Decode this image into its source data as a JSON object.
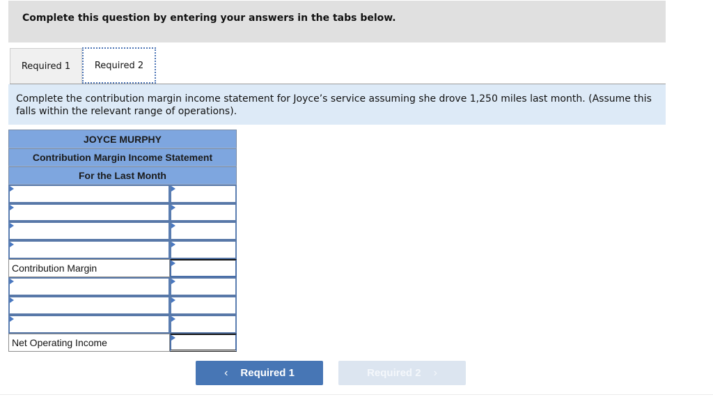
{
  "header": {
    "title": "Complete this question by entering your answers in the tabs below."
  },
  "tabs": [
    {
      "label": "Required 1",
      "active": false
    },
    {
      "label": "Required 2",
      "active": true
    }
  ],
  "instructions": "Complete the contribution margin income statement for Joyce’s service assuming she drove 1,250 miles last month. (Assume this falls within the relevant range of operations).",
  "statement": {
    "company": "JOYCE MURPHY",
    "title": "Contribution Margin Income Statement",
    "period": "For the Last Month",
    "rows": [
      {
        "type": "input",
        "label_value": "",
        "amount_value": ""
      },
      {
        "type": "input",
        "label_value": "",
        "amount_value": ""
      },
      {
        "type": "input",
        "label_value": "",
        "amount_value": ""
      },
      {
        "type": "input",
        "label_value": "",
        "amount_value": ""
      },
      {
        "type": "total",
        "label": "Contribution Margin",
        "amount_value": ""
      },
      {
        "type": "input",
        "label_value": "",
        "amount_value": ""
      },
      {
        "type": "input",
        "label_value": "",
        "amount_value": ""
      },
      {
        "type": "input",
        "label_value": "",
        "amount_value": ""
      },
      {
        "type": "total",
        "label": "Net Operating Income",
        "amount_value": ""
      }
    ]
  },
  "navigation": {
    "prev_label": "Required 1",
    "next_label": "Required 2",
    "prev_icon": "chevron-left-icon",
    "next_icon": "chevron-right-icon",
    "next_disabled": true
  }
}
